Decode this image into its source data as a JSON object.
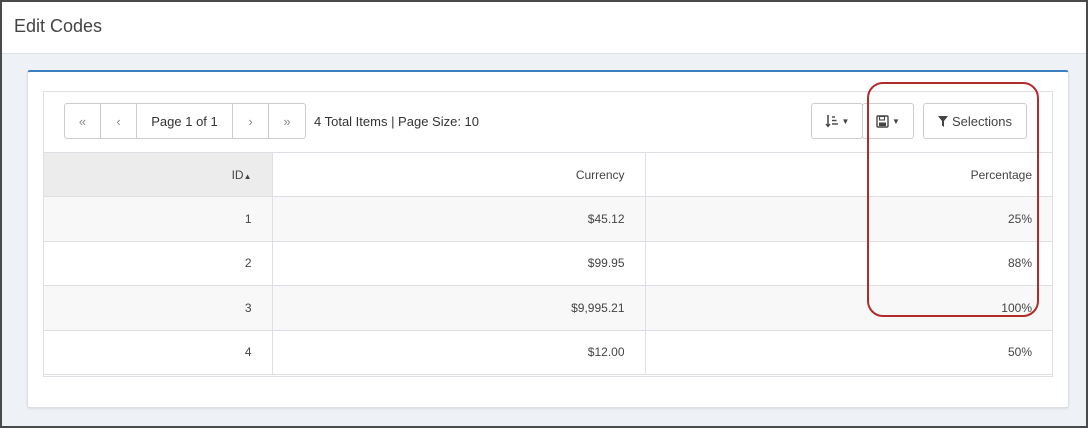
{
  "page": {
    "title": "Edit Codes"
  },
  "pager": {
    "first": "«",
    "prev": "‹",
    "info": "Page 1 of 1",
    "next": "›",
    "last": "»"
  },
  "summary": "4 Total Items | Page Size: 10",
  "toolbar": {
    "sort_icon": "sort-order-icon",
    "save_icon": "save-icon",
    "selections_label": "Selections",
    "selections_icon": "filter-icon"
  },
  "columns": {
    "id": "ID",
    "currency": "Currency",
    "percentage": "Percentage"
  },
  "rows": [
    {
      "id": "1",
      "currency": "$45.12",
      "percentage": "25%"
    },
    {
      "id": "2",
      "currency": "$99.95",
      "percentage": "88%"
    },
    {
      "id": "3",
      "currency": "$9,995.21",
      "percentage": "100%"
    },
    {
      "id": "4",
      "currency": "$12.00",
      "percentage": "50%"
    }
  ],
  "colors": {
    "accent": "#3c7fc1",
    "highlight": "#b32a2a"
  }
}
